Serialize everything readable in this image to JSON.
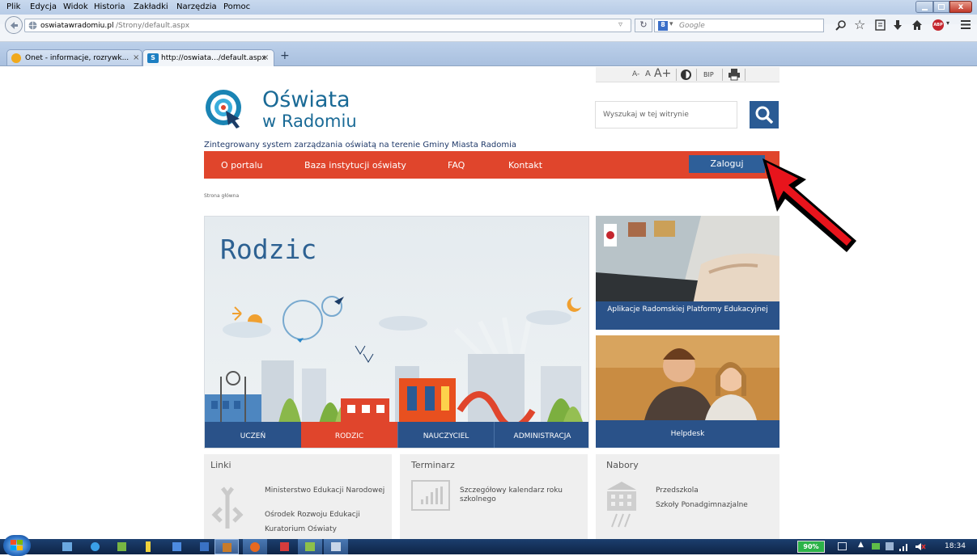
{
  "menu": [
    "Plik",
    "Edycja",
    "Widok",
    "Historia",
    "Zakładki",
    "Narzędzia",
    "Pomoc"
  ],
  "url": {
    "domain": "oswiatawradomiu.pl",
    "path": "/Strony/default.aspx"
  },
  "browser_search_placeholder": "Google",
  "tabs": [
    {
      "label": "Onet - informacje, rozrywk...",
      "close": "×"
    },
    {
      "label": "http://oswiata.../default.aspx",
      "close": "×"
    }
  ],
  "new_tab": "+",
  "toolbar": {
    "font_small": "A-",
    "font_normal": "A",
    "font_large": "A+",
    "bip": "BIP"
  },
  "logo": {
    "line1": "Oświata",
    "line2": "w Radomiu"
  },
  "site_search_placeholder": "Wyszukaj w tej witrynie",
  "tagline": "Zintegrowany system zarządzania oświatą na terenie Gminy Miasta Radomia",
  "nav": [
    "O portalu",
    "Baza instytucji oświaty",
    "FAQ",
    "Kontakt"
  ],
  "login": "Zaloguj",
  "breadcrumb": "Strona główna",
  "hero_title": "Rodzic",
  "categories": [
    "UCZEŃ",
    "RODZIC",
    "NAUCZYCIEL",
    "ADMINISTRACJA"
  ],
  "side_tiles": {
    "apps": "Aplikacje Radomskiej Platformy Edukacyjnej",
    "helpdesk": "Helpdesk"
  },
  "boxes": {
    "links": {
      "title": "Linki",
      "items": [
        "Ministerstwo Edukacji Narodowej",
        "Ośrodek Rozwoju Edukacji",
        "Kuratorium Oświaty"
      ]
    },
    "calendar": {
      "title": "Terminarz",
      "items": [
        "Szczegółowy kalendarz roku szkolnego"
      ]
    },
    "recruit": {
      "title": "Nabory",
      "items": [
        "Przedszkola",
        "Szkoły Ponadgimnazjalne"
      ]
    }
  },
  "taskbar": {
    "battery": "90%",
    "time": "18:34"
  },
  "colors": {
    "accent": "#e0452c",
    "dark_blue": "#2a5289",
    "login": "#2e5f99",
    "logo_blue": "#1a6a96"
  }
}
